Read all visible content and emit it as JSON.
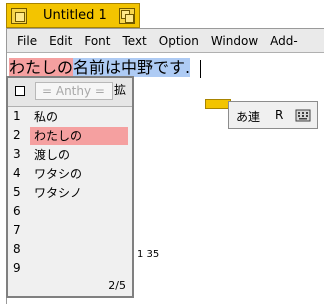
{
  "window": {
    "title": "Untitled 1"
  },
  "menubar": {
    "items": [
      "File",
      "Edit",
      "Font",
      "Text",
      "Option",
      "Window",
      "Add-"
    ]
  },
  "editor": {
    "preedit_segment_1": "わたしの",
    "preedit_segment_2": "名前は中野です.",
    "status_line": "1   35"
  },
  "candidate_window": {
    "engine_label": "= Anthy =",
    "expand_label": "拡",
    "candidates": [
      {
        "num": "1",
        "word": "私の"
      },
      {
        "num": "2",
        "word": "わたしの"
      },
      {
        "num": "3",
        "word": "渡しの"
      },
      {
        "num": "4",
        "word": "ワタシの"
      },
      {
        "num": "5",
        "word": "ワタシノ"
      },
      {
        "num": "6",
        "word": ""
      },
      {
        "num": "7",
        "word": ""
      },
      {
        "num": "8",
        "word": ""
      },
      {
        "num": "9",
        "word": ""
      }
    ],
    "selected_index": 1,
    "page_indicator": "2/5"
  },
  "ime_status": {
    "mode_label": "あ連",
    "r_label": "R",
    "icon": "keyboard-settings-icon"
  },
  "colors": {
    "title_bar": "#f3c400",
    "preedit_highlight_1": "#f5a0a0",
    "preedit_highlight_2": "#aecbf4",
    "candidate_selected": "#f5a0a0"
  }
}
